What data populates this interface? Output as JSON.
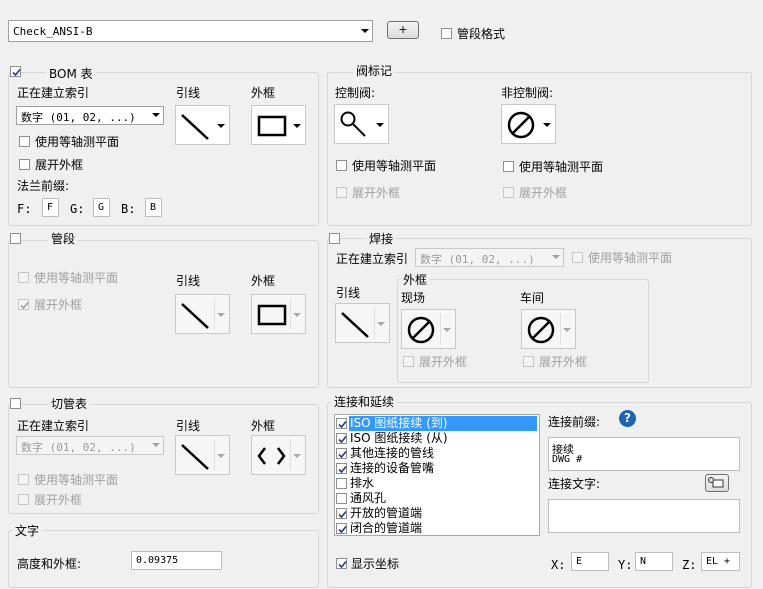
{
  "top": {
    "style_value": "Check_ANSI-B",
    "add_label": "+",
    "pipe_format_label": "管段格式",
    "pipe_format_checked": false
  },
  "bom": {
    "title": "BOM 表",
    "checked": true,
    "indexing_label": "正在建立索引",
    "indexing_value": "数字 (01, 02, ...)",
    "leader_label": "引线",
    "frame_label": "外框",
    "isometric_label": "使用等轴测平面",
    "expand_label": "展开外框",
    "flange_prefix_label": "法兰前缀:",
    "f_label": "F:",
    "f_value": "F",
    "g_label": "G:",
    "g_value": "G",
    "b_label": "B:",
    "b_value": "B"
  },
  "valve": {
    "title": "阀标记",
    "control_label": "控制阀:",
    "noncontrol_label": "非控制阀:",
    "isometric_label": "使用等轴测平面",
    "expand_label": "展开外框"
  },
  "pipe": {
    "title": "管段",
    "checked": false,
    "isometric_label": "使用等轴测平面",
    "expand_label": "展开外框",
    "expand_checked": true,
    "leader_label": "引线",
    "frame_label": "外框"
  },
  "weld": {
    "title": "焊接",
    "checked": false,
    "indexing_label": "正在建立索引",
    "indexing_value": "数字 (01, 02, ...)",
    "isometric_label": "使用等轴测平面",
    "leader_label": "引线",
    "frame_group": "外框",
    "field_label": "现场",
    "shop_label": "车间",
    "expand_label": "展开外框"
  },
  "cut": {
    "title": "切管表",
    "checked": false,
    "indexing_label": "正在建立索引",
    "indexing_value": "数字 (01, 02, ...)",
    "leader_label": "引线",
    "frame_label": "外框",
    "isometric_label": "使用等轴测平面",
    "expand_label": "展开外框"
  },
  "text": {
    "title": "文字",
    "height_label": "高度和外框:",
    "height_value": "0.09375"
  },
  "conn": {
    "title": "连接和延续",
    "items": [
      {
        "label": "ISO 图纸接续 (到)",
        "checked": true
      },
      {
        "label": "ISO 图纸接续 (从)",
        "checked": true
      },
      {
        "label": "其他连接的管线",
        "checked": true
      },
      {
        "label": "连接的设备管嘴",
        "checked": true
      },
      {
        "label": "排水",
        "checked": false
      },
      {
        "label": "通风孔",
        "checked": false
      },
      {
        "label": "开放的管道端",
        "checked": true
      },
      {
        "label": "闭合的管道端",
        "checked": true
      }
    ],
    "prefix_label": "连接前缀:",
    "prefix_line1": "接续",
    "prefix_line2": "DWG #",
    "text_label": "连接文字:",
    "show_coords_label": "显示坐标",
    "show_coords_checked": true,
    "x_label": "X:",
    "x_value": "E",
    "y_label": "Y:",
    "y_value": "N",
    "z_label": "Z:",
    "z_value": "EL +"
  },
  "colors": {
    "selection": "#3399ff",
    "help": "#1f63b5"
  }
}
